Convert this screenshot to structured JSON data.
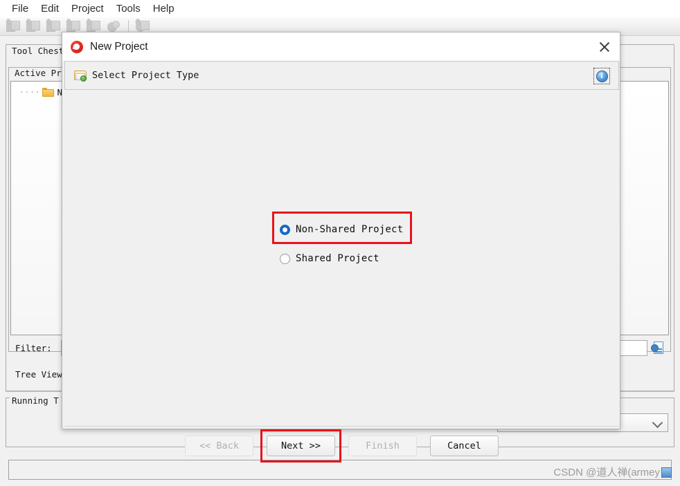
{
  "menubar": {
    "items": [
      {
        "label": "File"
      },
      {
        "label": "Edit"
      },
      {
        "label": "Project"
      },
      {
        "label": "Tools"
      },
      {
        "label": "Help"
      }
    ]
  },
  "toolbar": {
    "icons": [
      {
        "name": "new-project-icon"
      },
      {
        "name": "open-project-icon"
      },
      {
        "name": "save-project-icon"
      },
      {
        "name": "import-project-icon"
      },
      {
        "name": "export-project-icon"
      },
      {
        "name": "merge-icon"
      },
      {
        "name": "undo-icon"
      }
    ]
  },
  "background": {
    "tool_chest_title": "Tool Chest",
    "active_project_title": "Active Pr",
    "tree_item": "NO",
    "filter_label": "Filter:",
    "tree_view_label": "Tree View",
    "running_tasks_title": "Running T"
  },
  "dialog": {
    "title": "New Project",
    "app_icon": "new-project-app-icon",
    "close_icon": "close-icon",
    "header": {
      "icon": "folder-add-icon",
      "title": "Select Project Type",
      "info_icon": "info-icon"
    },
    "options": [
      {
        "label": "Non-Shared Project",
        "selected": true,
        "highlighted": true
      },
      {
        "label": "Shared Project",
        "selected": false,
        "highlighted": false
      }
    ],
    "buttons": [
      {
        "label": "<< Back",
        "enabled": false,
        "highlighted": false
      },
      {
        "label": "Next >>",
        "enabled": true,
        "highlighted": true
      },
      {
        "label": "Finish",
        "enabled": false,
        "highlighted": false
      },
      {
        "label": "Cancel",
        "enabled": true,
        "highlighted": false
      }
    ]
  },
  "status": {
    "watermark": "CSDN @道人禅(armey"
  },
  "colors": {
    "highlight": "#e8121a",
    "radio_selected": "#1669c1",
    "dialog_bg": "#f0f0f0",
    "window_bg": "#f1f1f1"
  }
}
